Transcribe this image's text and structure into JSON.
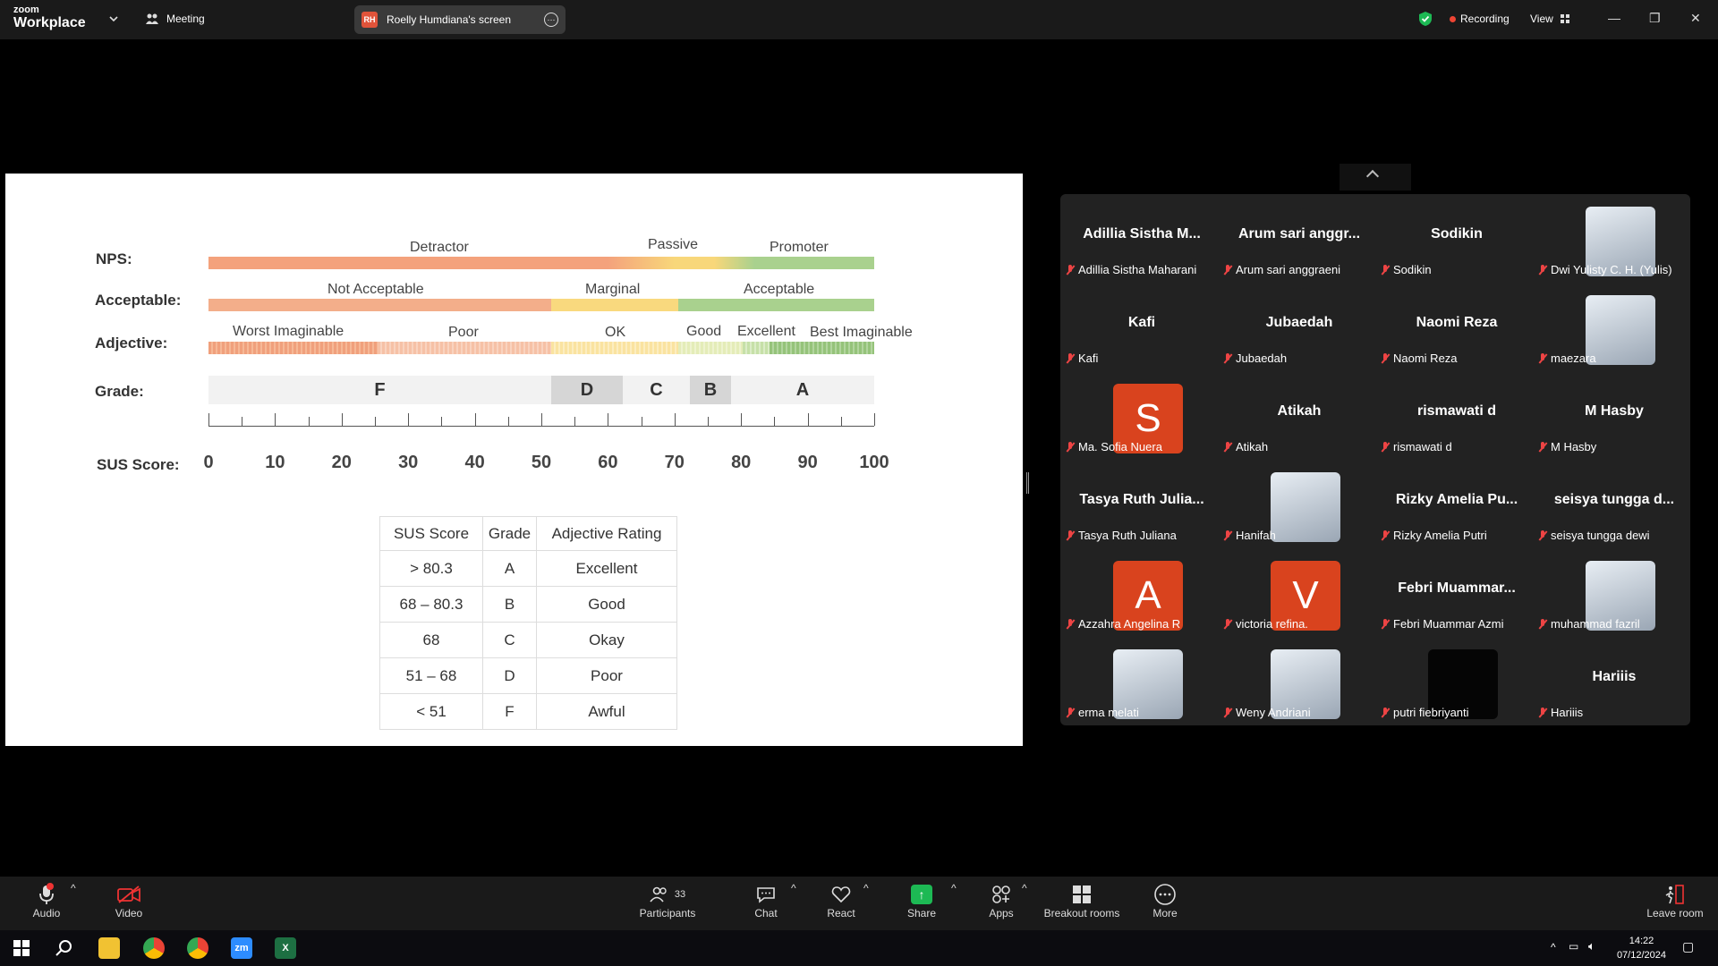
{
  "topbar": {
    "logo_small": "zoom",
    "logo_big": "Workplace",
    "meeting_label": "Meeting",
    "screen_initials": "RH",
    "screen_title": "Roelly Humdiana's screen",
    "recording_label": "Recording",
    "view_label": "View"
  },
  "slide": {
    "rows": {
      "nps": "NPS:",
      "acceptable": "Acceptable:",
      "adjective": "Adjective:",
      "grade": "Grade:",
      "sus": "SUS Score:"
    },
    "nps": {
      "detractor": "Detractor",
      "passive": "Passive",
      "promoter": "Promoter"
    },
    "acceptability": {
      "not_acceptable": "Not Acceptable",
      "marginal": "Marginal",
      "acceptable": "Acceptable"
    },
    "adjectives": {
      "worst": "Worst Imaginable",
      "poor": "Poor",
      "ok": "OK",
      "good": "Good",
      "excellent": "Excellent",
      "best": "Best Imaginable"
    },
    "grades": {
      "f": "F",
      "d": "D",
      "c": "C",
      "b": "B",
      "a": "A"
    },
    "scale": [
      "0",
      "10",
      "20",
      "30",
      "40",
      "50",
      "60",
      "70",
      "80",
      "90",
      "100"
    ],
    "table": {
      "headers": [
        "SUS Score",
        "Grade",
        "Adjective Rating"
      ],
      "rows": [
        [
          "> 80.3",
          "A",
          "Excellent"
        ],
        [
          "68 – 80.3",
          "B",
          "Good"
        ],
        [
          "68",
          "C",
          "Okay"
        ],
        [
          "51 – 68",
          "D",
          "Poor"
        ],
        [
          "< 51",
          "F",
          "Awful"
        ]
      ]
    },
    "colors": {
      "detractor": "#f2a07a",
      "passive": "#f7d36b",
      "promoter": "#a8d08d"
    }
  },
  "participants": [
    {
      "tile": "Adillia Sistha M...",
      "label": "Adillia Sistha Maharani"
    },
    {
      "tile": "Arum sari anggr...",
      "label": "Arum sari anggraeni"
    },
    {
      "tile": "Sodikin",
      "label": "Sodikin"
    },
    {
      "tile": "",
      "label": "Dwi Yulisty C. H. (Yulis)",
      "avatar": "photo"
    },
    {
      "tile": "Kafi",
      "label": "Kafi"
    },
    {
      "tile": "Jubaedah",
      "label": "Jubaedah"
    },
    {
      "tile": "Naomi Reza",
      "label": "Naomi Reza"
    },
    {
      "tile": "",
      "label": "maezara",
      "avatar": "photo"
    },
    {
      "tile": "",
      "label": "Ma. Sofia Nuera",
      "avatar": "S"
    },
    {
      "tile": "Atikah",
      "label": "Atikah"
    },
    {
      "tile": "rismawati d",
      "label": "rismawati d"
    },
    {
      "tile": "M Hasby",
      "label": "M Hasby"
    },
    {
      "tile": "Tasya Ruth Julia...",
      "label": "Tasya Ruth Juliana"
    },
    {
      "tile": "",
      "label": "Hanifah",
      "avatar": "photo"
    },
    {
      "tile": "Rizky Amelia Pu...",
      "label": "Rizky Amelia Putri"
    },
    {
      "tile": "seisya tungga d...",
      "label": "seisya tungga dewi"
    },
    {
      "tile": "",
      "label": "Azzahra Angelina R",
      "avatar": "A"
    },
    {
      "tile": "",
      "label": "victoria refina.",
      "avatar": "V"
    },
    {
      "tile": "Febri Muammar...",
      "label": "Febri Muammar Azmi"
    },
    {
      "tile": "",
      "label": "muhammad fazril",
      "avatar": "photo"
    },
    {
      "tile": "",
      "label": "erma melati",
      "avatar": "photo"
    },
    {
      "tile": "",
      "label": "Weny Andriani",
      "avatar": "photo"
    },
    {
      "tile": "",
      "label": "putri fiebriyanti",
      "avatar": "black"
    },
    {
      "tile": "Hariiis",
      "label": "Hariiis"
    }
  ],
  "toolbar": {
    "audio": "Audio",
    "video": "Video",
    "participants": "Participants",
    "participant_count": "33",
    "chat": "Chat",
    "react": "React",
    "share": "Share",
    "apps": "Apps",
    "breakout": "Breakout rooms",
    "more": "More",
    "leave": "Leave room"
  },
  "taskbar": {
    "time": "14:22",
    "date": "07/12/2024"
  }
}
